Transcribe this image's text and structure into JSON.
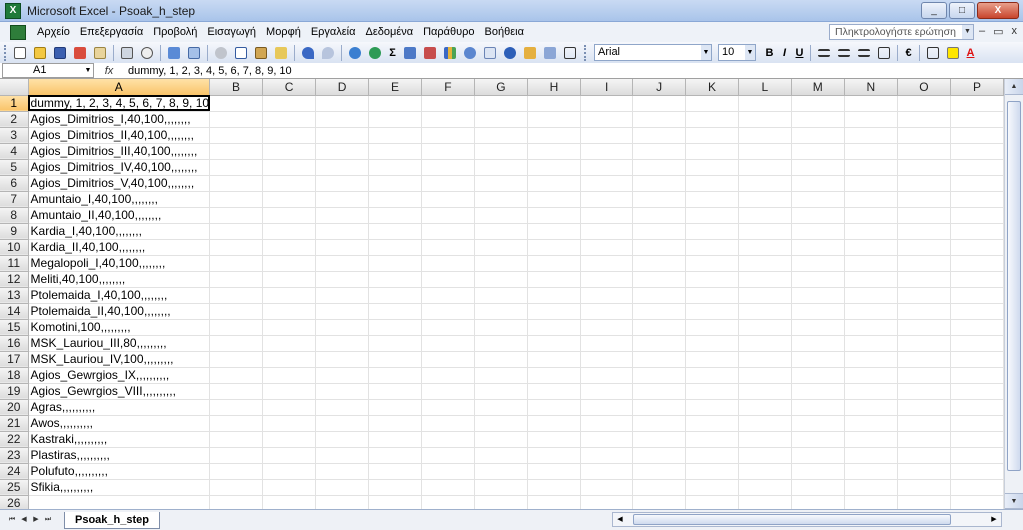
{
  "window": {
    "title": "Microsoft Excel - Psoak_h_step",
    "app_icon": "X",
    "minimize": "_",
    "maximize": "□",
    "close": "X"
  },
  "menu": {
    "items": [
      "Αρχείο",
      "Επεξεργασία",
      "Προβολή",
      "Εισαγωγή",
      "Μορφή",
      "Εργαλεία",
      "Δεδομένα",
      "Παράθυρο",
      "Βοήθεια"
    ],
    "help_placeholder": "Πληκτρολογήστε ερώτηση",
    "mdi_minimize": "–",
    "mdi_restore": "▭",
    "mdi_close": "x"
  },
  "toolbar": {
    "sigma": "Σ",
    "font": "Arial",
    "size": "10",
    "bold": "B",
    "italic": "I",
    "underline": "U",
    "euro": "€",
    "font_color": "A",
    "accent": "#1f7a3a"
  },
  "formula_bar": {
    "cell_ref": "A1",
    "fx": "fx",
    "formula": "dummy, 1, 2, 3, 4, 5, 6, 7, 8, 9, 10"
  },
  "grid": {
    "columns": [
      "A",
      "B",
      "C",
      "D",
      "E",
      "F",
      "G",
      "H",
      "I",
      "J",
      "K",
      "L",
      "M",
      "N",
      "O",
      "P"
    ],
    "rows": [
      "dummy, 1, 2, 3, 4, 5, 6, 7, 8, 9, 10",
      "Agios_Dimitrios_I,40,100,,,,,,,,",
      "Agios_Dimitrios_II,40,100,,,,,,,,",
      "Agios_Dimitrios_III,40,100,,,,,,,,",
      "Agios_Dimitrios_IV,40,100,,,,,,,,",
      "Agios_Dimitrios_V,40,100,,,,,,,,",
      "Amuntaio_I,40,100,,,,,,,,",
      "Amuntaio_II,40,100,,,,,,,,",
      "Kardia_I,40,100,,,,,,,,",
      "Kardia_II,40,100,,,,,,,,",
      "Megalopoli_I,40,100,,,,,,,,",
      "Meliti,40,100,,,,,,,,",
      "Ptolemaida_I,40,100,,,,,,,,",
      "Ptolemaida_II,40,100,,,,,,,,",
      "Komotini,100,,,,,,,,,",
      "MSK_Lauriou_III,80,,,,,,,,,",
      "MSK_Lauriou_IV,100,,,,,,,,,",
      "Agios_Gewrgios_IX,,,,,,,,,,",
      "Agios_Gewrgios_VIII,,,,,,,,,,",
      "Agras,,,,,,,,,,",
      "Awos,,,,,,,,,,",
      "Kastraki,,,,,,,,,,",
      "Plastiras,,,,,,,,,,",
      "Polufuto,,,,,,,,,,",
      "Sfikia,,,,,,,,,,",
      ""
    ]
  },
  "sheet_tab": "Psoak_h_step",
  "nav": [
    "⏮",
    "◀",
    "▶",
    "⏭"
  ]
}
